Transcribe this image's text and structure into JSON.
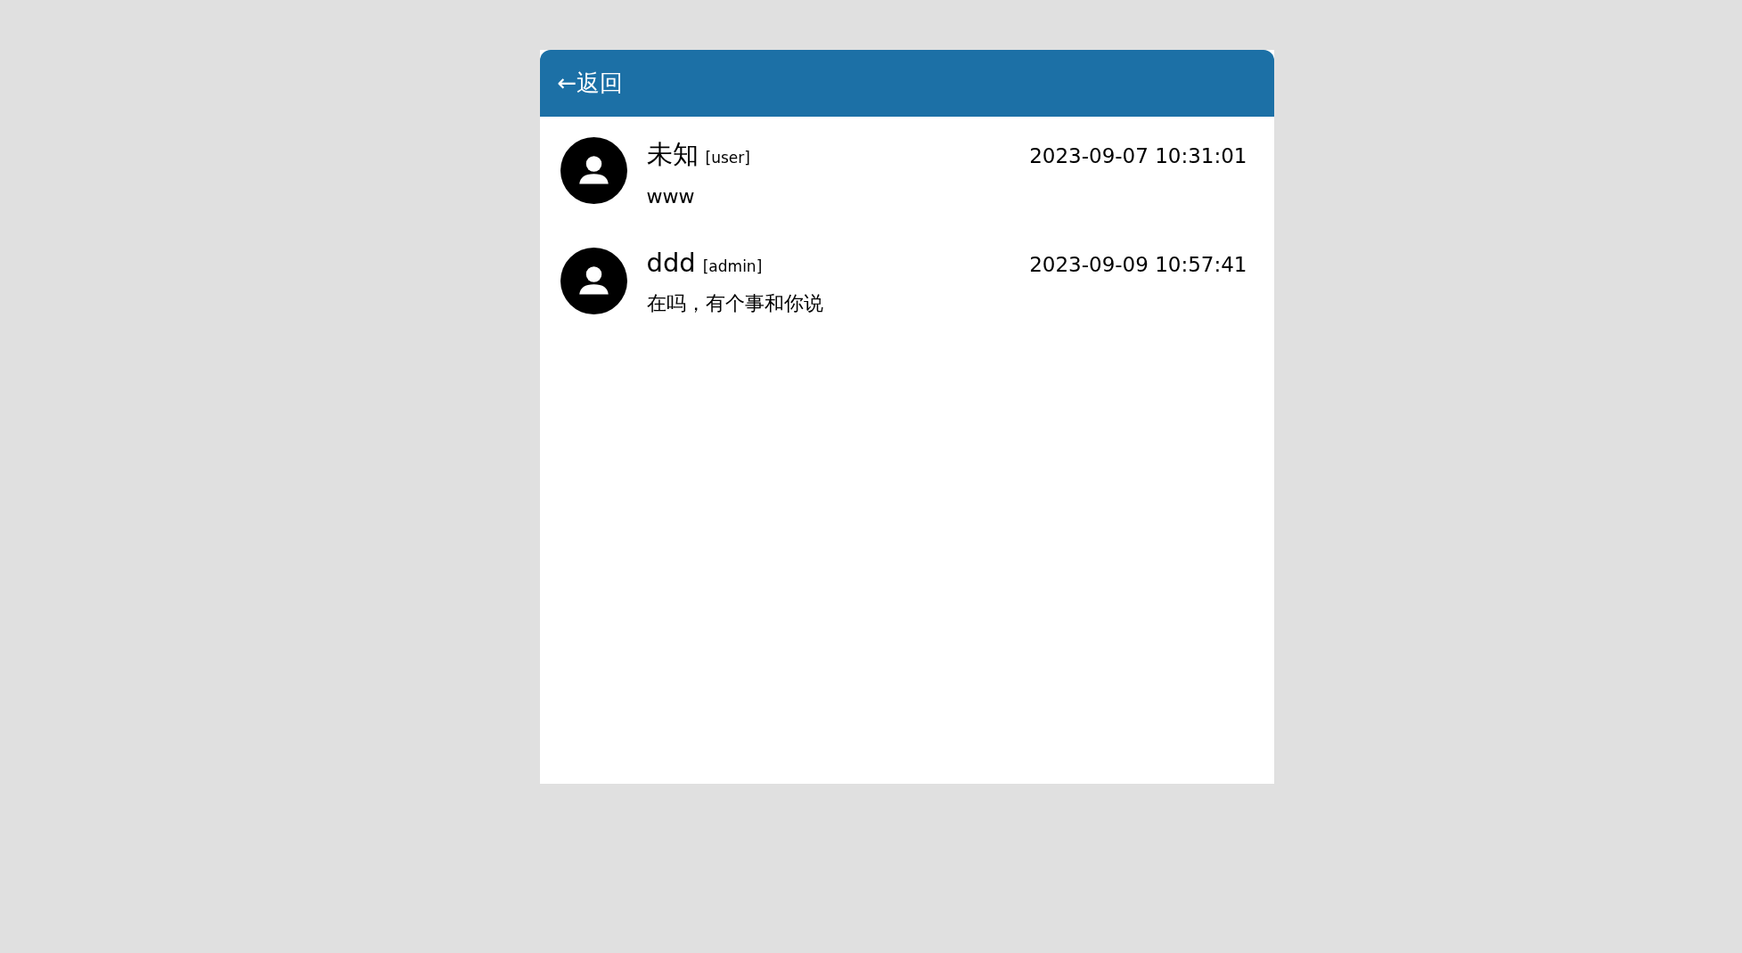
{
  "header": {
    "back_label": "←返回"
  },
  "messages": [
    {
      "name": "未知",
      "role": "[user]",
      "time": "2023-09-07 10:31:01",
      "text": "www"
    },
    {
      "name": "ddd",
      "role": "[admin]",
      "time": "2023-09-09 10:57:41",
      "text": "在吗，有个事和你说"
    }
  ]
}
